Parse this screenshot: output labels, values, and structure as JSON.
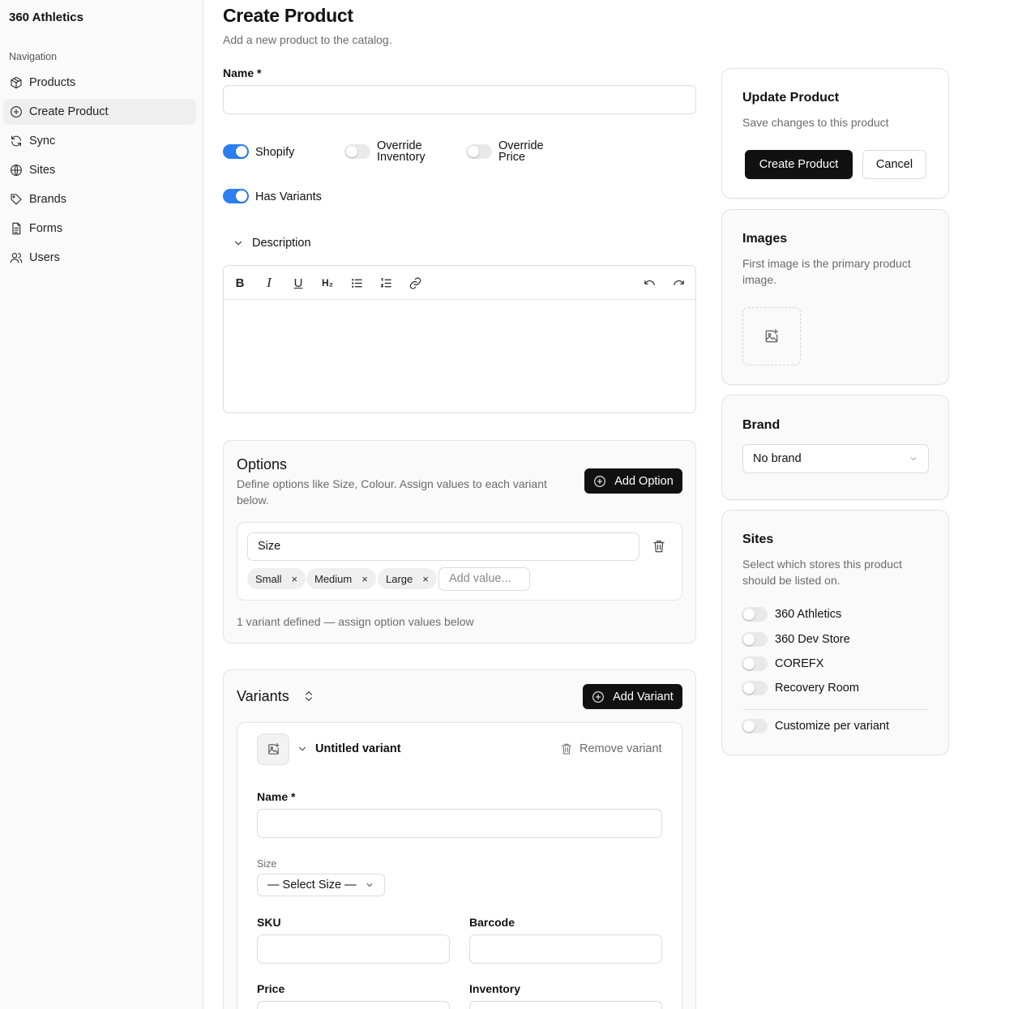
{
  "app": {
    "name": "360 Athletics"
  },
  "sidebar": {
    "heading": "Navigation",
    "items": [
      {
        "label": "Products",
        "icon": "package-icon"
      },
      {
        "label": "Create Product",
        "icon": "plus-circle-icon",
        "active": true
      },
      {
        "label": "Sync",
        "icon": "refresh-icon"
      },
      {
        "label": "Sites",
        "icon": "globe-icon"
      },
      {
        "label": "Brands",
        "icon": "tag-icon"
      },
      {
        "label": "Forms",
        "icon": "document-icon"
      },
      {
        "label": "Users",
        "icon": "users-icon"
      }
    ]
  },
  "page": {
    "title": "Create Product",
    "subtitle": "Add a new product to the catalog."
  },
  "form": {
    "name_label": "Name *",
    "name_value": "",
    "toggles": {
      "shopify": {
        "label": "Shopify",
        "on": true
      },
      "override_inventory": {
        "label_line1": "Override",
        "label_line2": "Inventory",
        "on": false
      },
      "override_price": {
        "label_line1": "Override",
        "label_line2": "Price",
        "on": false
      },
      "has_variants": {
        "label": "Has Variants",
        "on": true
      }
    },
    "description_label": "Description"
  },
  "editor": {
    "toolbar": [
      "bold-icon",
      "italic-icon",
      "underline-icon",
      "heading-2-icon",
      "bullet-list-icon",
      "numbered-list-icon",
      "link-icon",
      "undo-icon",
      "redo-icon"
    ],
    "h2_label": "H₂",
    "bold_label": "B",
    "italic_label": "I",
    "underline_label": "U"
  },
  "options": {
    "title": "Options",
    "description": "Define options like Size, Colour. Assign values to each variant below.",
    "add_button": "Add Option",
    "option_name": "Size",
    "values": [
      "Small",
      "Medium",
      "Large"
    ],
    "remove_glyph": "×",
    "value_placeholder": "Add value...",
    "summary": "1 variant defined — assign option values below"
  },
  "variants": {
    "title": "Variants",
    "add_button": "Add Variant",
    "variant_name": "Untitled variant",
    "remove_label": "Remove variant",
    "name_label": "Name *",
    "size_label": "Size",
    "size_select": "— Select Size —",
    "sku_label": "SKU",
    "barcode_label": "Barcode",
    "price_label": "Price",
    "inventory_label": "Inventory"
  },
  "update_card": {
    "title": "Update Product",
    "description": "Save changes to this product",
    "primary_button": "Create Product",
    "secondary_button": "Cancel"
  },
  "images_card": {
    "title": "Images",
    "description": "First image is the primary product image."
  },
  "brand_card": {
    "title": "Brand",
    "selected": "No brand"
  },
  "sites_card": {
    "title": "Sites",
    "description": "Select which stores this product should be listed on.",
    "sites": [
      {
        "label": "360 Athletics",
        "on": false
      },
      {
        "label": "360 Dev Store",
        "on": false
      },
      {
        "label": "COREFX",
        "on": false
      },
      {
        "label": "Recovery Room",
        "on": false
      }
    ],
    "customize_label": "Customize per variant",
    "customize_on": false
  },
  "colors": {
    "accent": "#2b7ff0",
    "primary_button": "#111111"
  }
}
